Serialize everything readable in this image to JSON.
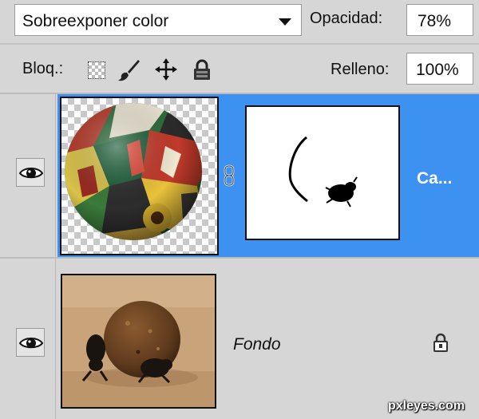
{
  "blend": {
    "mode_value": "Sobreexponer color",
    "opacity_label": "Opacidad:",
    "opacity_value": "78%"
  },
  "lock": {
    "label": "Bloq.:",
    "icons": [
      "lock-transparency-icon",
      "lock-image-brush-icon",
      "lock-position-move-icon",
      "lock-all-padlock-icon"
    ],
    "fill_label": "Relleno:",
    "fill_value": "100%"
  },
  "layers": [
    {
      "name": "Ca...",
      "selected": true,
      "visible": true,
      "has_mask": true,
      "linked": true,
      "thumbnail": "patchwork-fabric-sphere-on-transparency",
      "mask": "white-with-black-arc-and-beetle"
    },
    {
      "name": "Fondo",
      "selected": false,
      "visible": true,
      "locked": true,
      "thumbnail": "dung-beetle-rolling-ball-on-dirt"
    }
  ],
  "colors": {
    "panel_bg": "#d6d6d6",
    "selection": "#3d91f0",
    "input_bg": "#ffffff"
  },
  "watermark": "pxleyes.com"
}
